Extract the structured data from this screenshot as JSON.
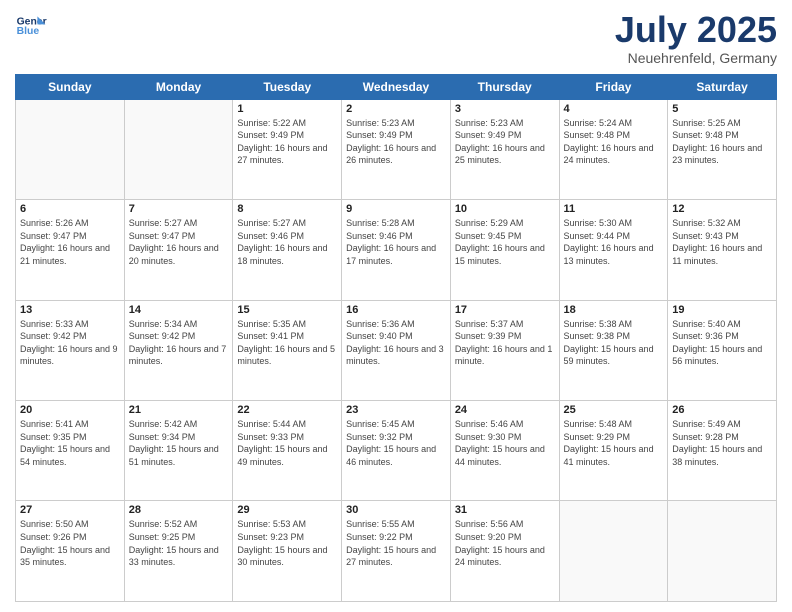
{
  "logo": {
    "line1": "General",
    "line2": "Blue"
  },
  "title": "July 2025",
  "location": "Neuehrenfeld, Germany",
  "days_of_week": [
    "Sunday",
    "Monday",
    "Tuesday",
    "Wednesday",
    "Thursday",
    "Friday",
    "Saturday"
  ],
  "weeks": [
    [
      {
        "day": "",
        "info": ""
      },
      {
        "day": "",
        "info": ""
      },
      {
        "day": "1",
        "sunrise": "Sunrise: 5:22 AM",
        "sunset": "Sunset: 9:49 PM",
        "daylight": "Daylight: 16 hours and 27 minutes."
      },
      {
        "day": "2",
        "sunrise": "Sunrise: 5:23 AM",
        "sunset": "Sunset: 9:49 PM",
        "daylight": "Daylight: 16 hours and 26 minutes."
      },
      {
        "day": "3",
        "sunrise": "Sunrise: 5:23 AM",
        "sunset": "Sunset: 9:49 PM",
        "daylight": "Daylight: 16 hours and 25 minutes."
      },
      {
        "day": "4",
        "sunrise": "Sunrise: 5:24 AM",
        "sunset": "Sunset: 9:48 PM",
        "daylight": "Daylight: 16 hours and 24 minutes."
      },
      {
        "day": "5",
        "sunrise": "Sunrise: 5:25 AM",
        "sunset": "Sunset: 9:48 PM",
        "daylight": "Daylight: 16 hours and 23 minutes."
      }
    ],
    [
      {
        "day": "6",
        "sunrise": "Sunrise: 5:26 AM",
        "sunset": "Sunset: 9:47 PM",
        "daylight": "Daylight: 16 hours and 21 minutes."
      },
      {
        "day": "7",
        "sunrise": "Sunrise: 5:27 AM",
        "sunset": "Sunset: 9:47 PM",
        "daylight": "Daylight: 16 hours and 20 minutes."
      },
      {
        "day": "8",
        "sunrise": "Sunrise: 5:27 AM",
        "sunset": "Sunset: 9:46 PM",
        "daylight": "Daylight: 16 hours and 18 minutes."
      },
      {
        "day": "9",
        "sunrise": "Sunrise: 5:28 AM",
        "sunset": "Sunset: 9:46 PM",
        "daylight": "Daylight: 16 hours and 17 minutes."
      },
      {
        "day": "10",
        "sunrise": "Sunrise: 5:29 AM",
        "sunset": "Sunset: 9:45 PM",
        "daylight": "Daylight: 16 hours and 15 minutes."
      },
      {
        "day": "11",
        "sunrise": "Sunrise: 5:30 AM",
        "sunset": "Sunset: 9:44 PM",
        "daylight": "Daylight: 16 hours and 13 minutes."
      },
      {
        "day": "12",
        "sunrise": "Sunrise: 5:32 AM",
        "sunset": "Sunset: 9:43 PM",
        "daylight": "Daylight: 16 hours and 11 minutes."
      }
    ],
    [
      {
        "day": "13",
        "sunrise": "Sunrise: 5:33 AM",
        "sunset": "Sunset: 9:42 PM",
        "daylight": "Daylight: 16 hours and 9 minutes."
      },
      {
        "day": "14",
        "sunrise": "Sunrise: 5:34 AM",
        "sunset": "Sunset: 9:42 PM",
        "daylight": "Daylight: 16 hours and 7 minutes."
      },
      {
        "day": "15",
        "sunrise": "Sunrise: 5:35 AM",
        "sunset": "Sunset: 9:41 PM",
        "daylight": "Daylight: 16 hours and 5 minutes."
      },
      {
        "day": "16",
        "sunrise": "Sunrise: 5:36 AM",
        "sunset": "Sunset: 9:40 PM",
        "daylight": "Daylight: 16 hours and 3 minutes."
      },
      {
        "day": "17",
        "sunrise": "Sunrise: 5:37 AM",
        "sunset": "Sunset: 9:39 PM",
        "daylight": "Daylight: 16 hours and 1 minute."
      },
      {
        "day": "18",
        "sunrise": "Sunrise: 5:38 AM",
        "sunset": "Sunset: 9:38 PM",
        "daylight": "Daylight: 15 hours and 59 minutes."
      },
      {
        "day": "19",
        "sunrise": "Sunrise: 5:40 AM",
        "sunset": "Sunset: 9:36 PM",
        "daylight": "Daylight: 15 hours and 56 minutes."
      }
    ],
    [
      {
        "day": "20",
        "sunrise": "Sunrise: 5:41 AM",
        "sunset": "Sunset: 9:35 PM",
        "daylight": "Daylight: 15 hours and 54 minutes."
      },
      {
        "day": "21",
        "sunrise": "Sunrise: 5:42 AM",
        "sunset": "Sunset: 9:34 PM",
        "daylight": "Daylight: 15 hours and 51 minutes."
      },
      {
        "day": "22",
        "sunrise": "Sunrise: 5:44 AM",
        "sunset": "Sunset: 9:33 PM",
        "daylight": "Daylight: 15 hours and 49 minutes."
      },
      {
        "day": "23",
        "sunrise": "Sunrise: 5:45 AM",
        "sunset": "Sunset: 9:32 PM",
        "daylight": "Daylight: 15 hours and 46 minutes."
      },
      {
        "day": "24",
        "sunrise": "Sunrise: 5:46 AM",
        "sunset": "Sunset: 9:30 PM",
        "daylight": "Daylight: 15 hours and 44 minutes."
      },
      {
        "day": "25",
        "sunrise": "Sunrise: 5:48 AM",
        "sunset": "Sunset: 9:29 PM",
        "daylight": "Daylight: 15 hours and 41 minutes."
      },
      {
        "day": "26",
        "sunrise": "Sunrise: 5:49 AM",
        "sunset": "Sunset: 9:28 PM",
        "daylight": "Daylight: 15 hours and 38 minutes."
      }
    ],
    [
      {
        "day": "27",
        "sunrise": "Sunrise: 5:50 AM",
        "sunset": "Sunset: 9:26 PM",
        "daylight": "Daylight: 15 hours and 35 minutes."
      },
      {
        "day": "28",
        "sunrise": "Sunrise: 5:52 AM",
        "sunset": "Sunset: 9:25 PM",
        "daylight": "Daylight: 15 hours and 33 minutes."
      },
      {
        "day": "29",
        "sunrise": "Sunrise: 5:53 AM",
        "sunset": "Sunset: 9:23 PM",
        "daylight": "Daylight: 15 hours and 30 minutes."
      },
      {
        "day": "30",
        "sunrise": "Sunrise: 5:55 AM",
        "sunset": "Sunset: 9:22 PM",
        "daylight": "Daylight: 15 hours and 27 minutes."
      },
      {
        "day": "31",
        "sunrise": "Sunrise: 5:56 AM",
        "sunset": "Sunset: 9:20 PM",
        "daylight": "Daylight: 15 hours and 24 minutes."
      },
      {
        "day": "",
        "info": ""
      },
      {
        "day": "",
        "info": ""
      }
    ]
  ]
}
